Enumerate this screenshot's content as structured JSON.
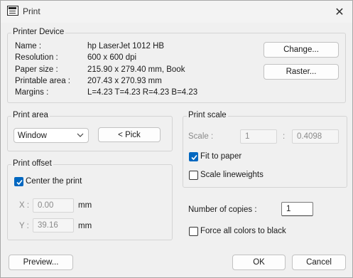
{
  "window": {
    "title": "Print",
    "close_glyph": "✕"
  },
  "printer_device": {
    "label": "Printer Device",
    "name_label": "Name :",
    "name_value": "hp LaserJet 1012 HB",
    "resolution_label": "Resolution :",
    "resolution_value": "600 x 600 dpi",
    "paper_label": "Paper size :",
    "paper_value": "215.90 x 279.40 mm,  Book",
    "printable_label": "Printable area :",
    "printable_value": "207.43 x 270.93 mm",
    "margins_label": "Margins :",
    "margins_value": "L=4.23  T=4.23  R=4.23  B=4.23",
    "change_button": "Change...",
    "raster_button": "Raster..."
  },
  "print_area": {
    "label": "Print area",
    "selected": "Window",
    "pick_button": "< Pick"
  },
  "print_offset": {
    "label": "Print offset",
    "center_label": "Center the print",
    "center_checked": true,
    "x_label": "X :",
    "x_value": "0.00",
    "x_unit": "mm",
    "y_label": "Y :",
    "y_value": "39.16",
    "y_unit": "mm"
  },
  "print_scale": {
    "label": "Print scale",
    "scale_label": "Scale :",
    "scale_left": "1",
    "colon": ":",
    "scale_right": "0.4098",
    "fit_label": "Fit to paper",
    "fit_checked": true,
    "lineweights_label": "Scale lineweights",
    "lineweights_checked": false
  },
  "copies": {
    "label": "Number of copies :",
    "value": "1"
  },
  "force_black": {
    "label": "Force all colors to black",
    "checked": false
  },
  "footer": {
    "preview_button": "Preview...",
    "ok_button": "OK",
    "cancel_button": "Cancel"
  },
  "colors": {
    "accent": "#0067c0"
  }
}
